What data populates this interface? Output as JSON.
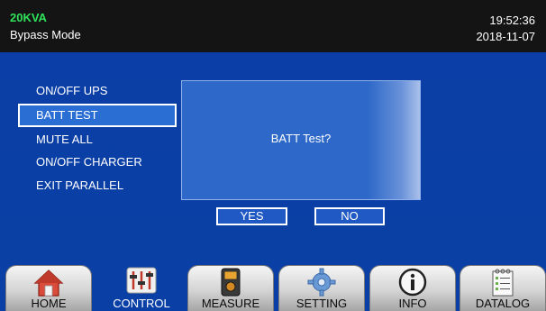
{
  "header": {
    "model": "20KVA",
    "mode": "Bypass Mode",
    "time": "19:52:36",
    "date": "2018-11-07"
  },
  "menu": {
    "items": [
      {
        "label": "ON/OFF UPS",
        "selected": false
      },
      {
        "label": "BATT TEST",
        "selected": true
      },
      {
        "label": "MUTE ALL",
        "selected": false
      },
      {
        "label": "ON/OFF CHARGER",
        "selected": false
      },
      {
        "label": "EXIT PARALLEL",
        "selected": false
      }
    ]
  },
  "dialog": {
    "message": "BATT Test?",
    "yes_label": "YES",
    "no_label": "NO"
  },
  "nav": {
    "tabs": [
      {
        "label": "HOME",
        "icon": "home-icon"
      },
      {
        "label": "CONTROL",
        "icon": "sliders-icon",
        "active": true
      },
      {
        "label": "MEASURE",
        "icon": "meter-icon"
      },
      {
        "label": "SETTING",
        "icon": "gear-icon"
      },
      {
        "label": "INFO",
        "icon": "info-icon"
      },
      {
        "label": "DATALOG",
        "icon": "notepad-icon"
      }
    ]
  },
  "colors": {
    "background": "#0a3fa6",
    "header": "#141414",
    "model_text": "#2fe35a",
    "selected_item": "#2a6ed4"
  }
}
